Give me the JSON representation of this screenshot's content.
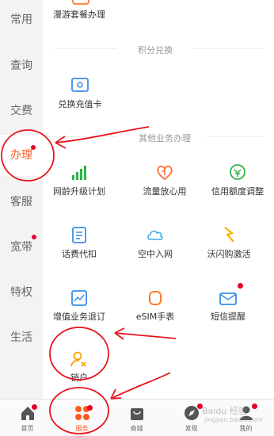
{
  "sidebar": {
    "items": [
      {
        "label": "常用"
      },
      {
        "label": "查询"
      },
      {
        "label": "交费"
      },
      {
        "label": "办理"
      },
      {
        "label": "客服"
      },
      {
        "label": "宽带"
      },
      {
        "label": "特权"
      },
      {
        "label": "生活"
      }
    ]
  },
  "main": {
    "top_item": {
      "label": "漫游套餐办理"
    },
    "sections": {
      "points": {
        "title": "积分兑换",
        "items": [
          {
            "label": "兑换充值卡",
            "icon": "card-icon"
          }
        ]
      },
      "other": {
        "title": "其他业务办理",
        "items": [
          {
            "label": "网龄升级计划",
            "icon": "signal-bars-icon"
          },
          {
            "label": "流量放心用",
            "icon": "heart-flow-icon"
          },
          {
            "label": "信用额度调整",
            "icon": "credit-icon"
          },
          {
            "label": "话费代扣",
            "icon": "clipboard-icon"
          },
          {
            "label": "空中入网",
            "icon": "cloud-icon"
          },
          {
            "label": "沃闪购激活",
            "icon": "lightning-icon"
          },
          {
            "label": "增值业务退订",
            "icon": "chart-exit-icon"
          },
          {
            "label": "eSIM手表",
            "icon": "watch-icon"
          },
          {
            "label": "短信提醒",
            "icon": "mail-icon"
          },
          {
            "label": "销户",
            "icon": "user-x-icon"
          }
        ]
      }
    }
  },
  "tabbar": {
    "tabs": [
      {
        "label": "首页",
        "icon": "home-icon"
      },
      {
        "label": "服务",
        "icon": "grid-icon"
      },
      {
        "label": "商城",
        "icon": "bag-icon"
      },
      {
        "label": "发现",
        "icon": "compass-icon"
      },
      {
        "label": "我的",
        "icon": "person-icon"
      }
    ]
  },
  "colors": {
    "accent": "#ff5a1f",
    "badge": "#e5002a",
    "annotation": "#e8141c"
  },
  "watermark": {
    "text": "Baidu 经验",
    "url": "jingyan.baidu.com"
  }
}
